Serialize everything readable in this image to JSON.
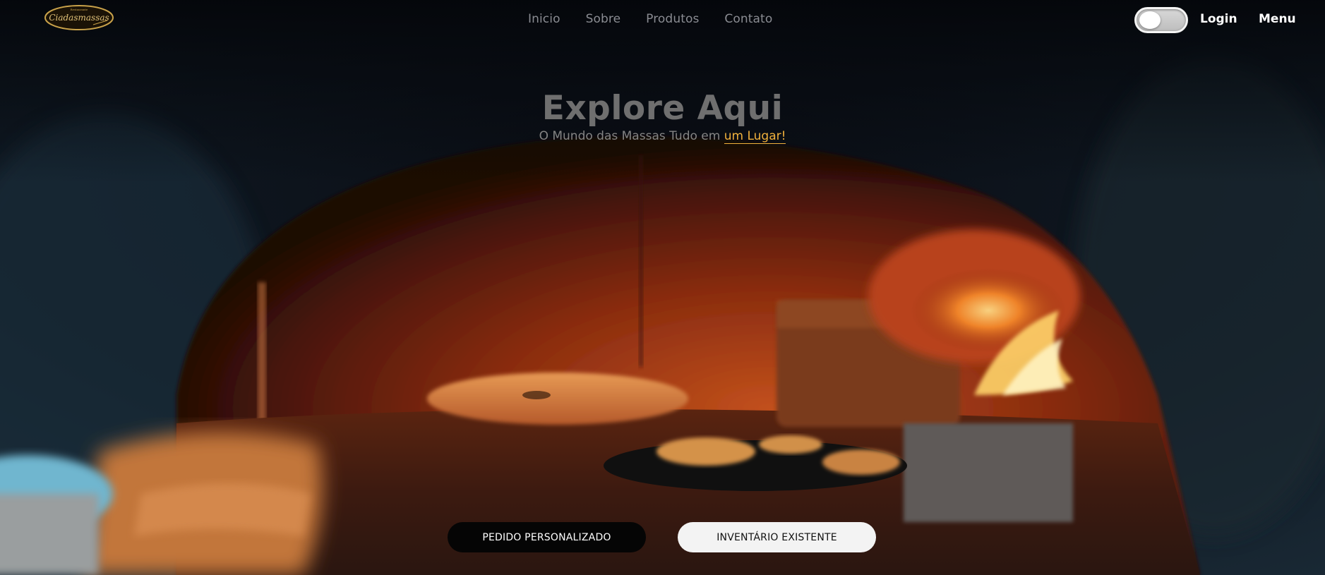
{
  "brand": {
    "logo_small_text": "Restaurante",
    "logo_text": "Ciadasmassas"
  },
  "nav": {
    "items": [
      {
        "label": "Inicio"
      },
      {
        "label": "Sobre"
      },
      {
        "label": "Produtos"
      },
      {
        "label": "Contato"
      }
    ]
  },
  "header": {
    "toggle_icon": "theme-toggle",
    "login_label": "Login",
    "menu_label": "Menu"
  },
  "hero": {
    "title": "Explore Aqui",
    "subtitle_prefix": "O Mundo das Massas Tudo em ",
    "subtitle_highlight": "um Lugar!"
  },
  "actions": {
    "primary_label": "PEDIDO PERSONALIZADO",
    "secondary_label": "INVENTÁRIO EXISTENTE"
  },
  "colors": {
    "accent": "#f0b13c",
    "nav_text": "#8a8c92",
    "button_dark": "#050505",
    "button_light": "#f3f3f3"
  }
}
